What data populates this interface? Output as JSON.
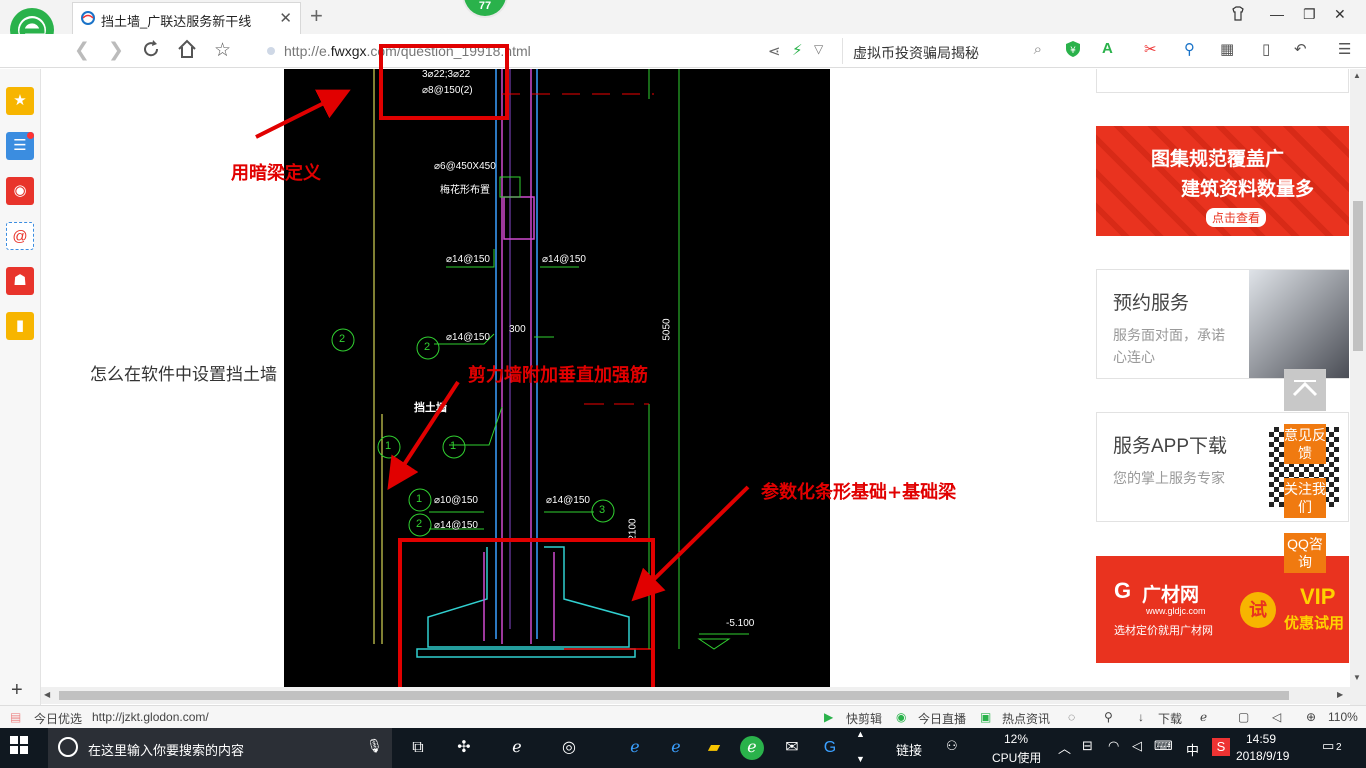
{
  "browser": {
    "tab_title": "挡土墙_广联达服务新干线",
    "badge_count": "77",
    "url_prefix": "http://e.",
    "url_domain": "fwxgx",
    "url_rest": ".com/question_19",
    "url_tail": "918.html",
    "search_text": "虚拟币投资骗局揭秘"
  },
  "page": {
    "question_text": "怎么在软件中设置挡土墙",
    "annotations": {
      "hidden_beam": "用暗梁定义",
      "shear_wall": "剪力墙附加垂直加强筋",
      "foundation": "参数化条形基础+基础梁"
    },
    "cad_labels": {
      "rebar_top_1": "3⌀22;3⌀22",
      "rebar_top_2": "⌀8@150(2)",
      "rebar_mid_1": "⌀6@450X450",
      "rebar_mid_2": "梅花形布置",
      "rebar_left_150": "⌀14@150",
      "rebar_right_150": "⌀14@150",
      "rebar_2a": "⌀14@150",
      "dim_300": "300",
      "dim_5050": "5050",
      "wall_label": "挡土墙",
      "rebar_1b": "⌀10@150",
      "rebar_2b": "⌀14@150",
      "rebar_3": "⌀14@150",
      "dim_2100": "2100",
      "elev": "-5.100",
      "circle_2": "2",
      "circle_1": "1",
      "circle_3": "3"
    }
  },
  "right": {
    "banner1_line1": "图集规范覆盖广",
    "banner1_line2": "建筑资料数量多",
    "banner1_btn": "点击查看",
    "card1_title": "预约服务",
    "card1_sub": "服务面对面，承诺心连心",
    "card2_title": "服务APP下载",
    "card2_sub": "您的掌上服务专家",
    "banner2_brand": "广材网",
    "banner2_url": "www.gldjc.com",
    "banner2_slogan": "选材定价就用广材网",
    "banner2_try": "试",
    "banner2_vip1": "VIP",
    "banner2_vip2": "优惠试用",
    "float_feedback": "意见反馈",
    "float_follow": "关注我们",
    "float_qq": "QQ咨询"
  },
  "statusbar": {
    "daily": "今日优选",
    "url": "http://jzkt.glodon.com/",
    "clip": "快剪辑",
    "live": "今日直播",
    "news": "热点资讯",
    "download": "下载",
    "zoom": "110%"
  },
  "taskbar": {
    "search_placeholder": "在这里输入你要搜索的内容",
    "link": "链接",
    "cpu_pct": "12%",
    "cpu_label": "CPU使用",
    "ime": "中",
    "time": "14:59",
    "date": "2018/9/19",
    "notif": "2"
  },
  "colors": {
    "annotation_red": "#e10000",
    "accent_orange": "#f07a10",
    "browser_green": "#2ab24b"
  }
}
